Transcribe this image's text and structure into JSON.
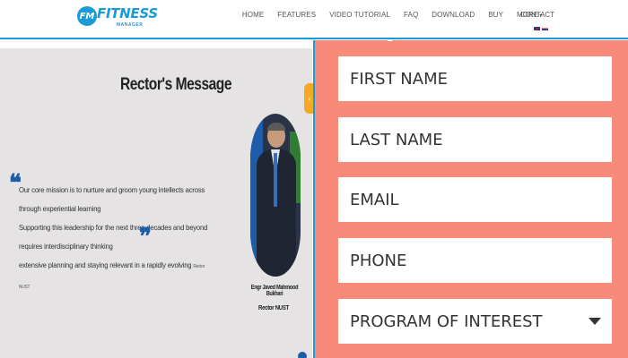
{
  "header": {
    "logo_badge": "FM",
    "logo_text": "FITNESS",
    "logo_sub": "MANAGER",
    "nav": [
      {
        "label": "HOME"
      },
      {
        "label": "FEATURES"
      },
      {
        "label": "VIDEO TUTORIAL"
      },
      {
        "label": "FAQ"
      },
      {
        "label": "DOWNLOAD"
      },
      {
        "label": "BUY"
      },
      {
        "label": "MORE"
      }
    ],
    "contact": "CONTACT"
  },
  "rector": {
    "title": "Rector's Message",
    "quote_line1": "Our core mission is to nurture and groom young intellects across through experiential learning",
    "quote_line2": "Supporting this leadership for the next three decades and beyond requires interdisciplinary thinking",
    "quote_line3": "extensive planning and staying relevant in a rapidly evolving",
    "quote_author": "Rector NUST",
    "name": "Engr Javed Mahmood Bukhari",
    "role": "Rector NUST"
  },
  "form": {
    "first_name_placeholder": "FIRST NAME",
    "last_name_placeholder": "LAST NAME",
    "email_placeholder": "EMAIL",
    "phone_placeholder": "PHONE",
    "program_label": "PROGRAM OF INTEREST"
  },
  "colors": {
    "brand": "#1a9ad6",
    "form_bg": "#f88a79",
    "quote_mark": "#1d5ca8",
    "side_tab": "#f4a826"
  }
}
